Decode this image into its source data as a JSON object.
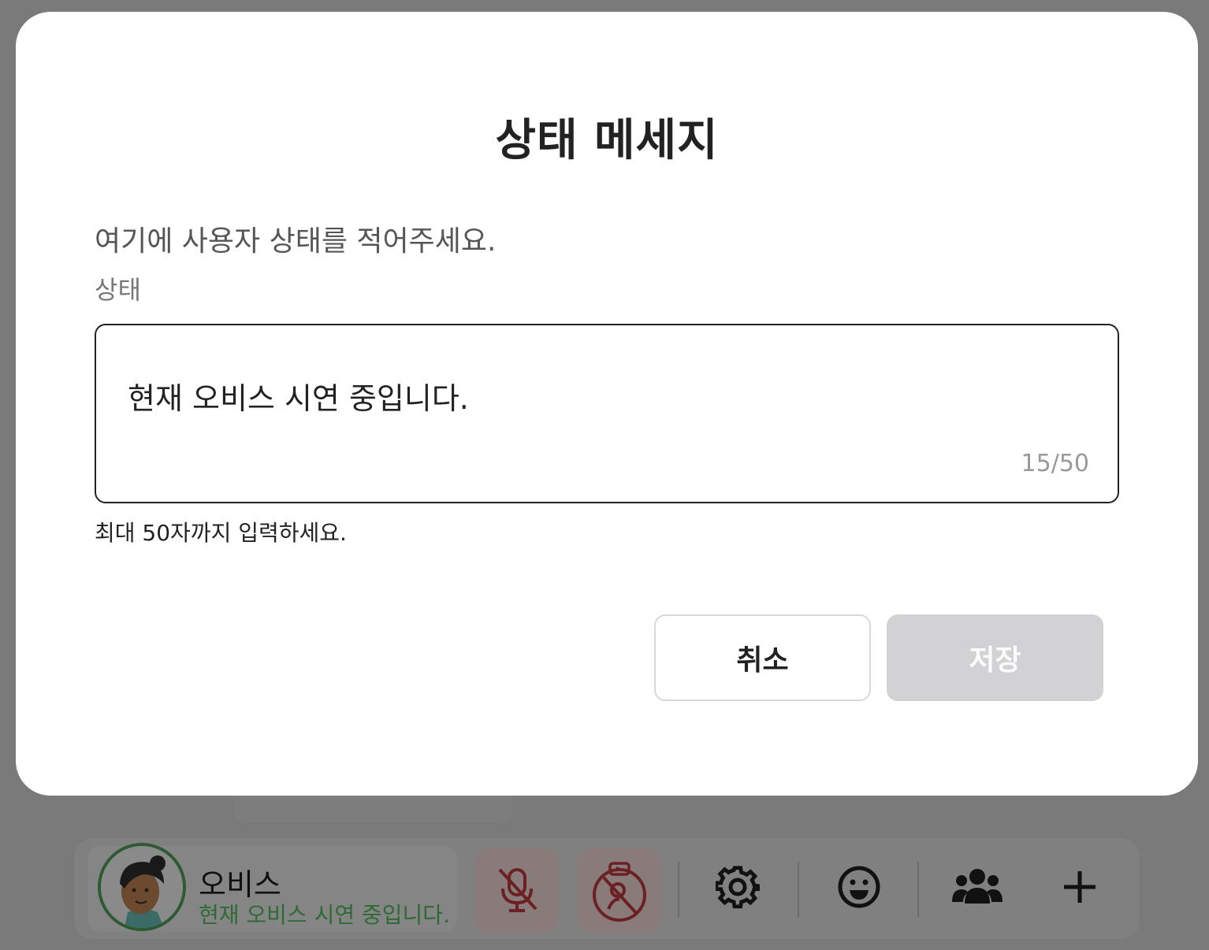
{
  "modal": {
    "title": "상태 메세지",
    "description": "여기에 사용자 상태를 적어주세요.",
    "field_label": "상태",
    "input_value": "현재 오비스 시연 중입니다.",
    "char_count": "15/50",
    "helper_text": "최대 50자까지 입력하세요.",
    "cancel_label": "취소",
    "save_label": "저장"
  },
  "toolbar": {
    "user_name": "오비스",
    "user_status": "현재 오비스 시연 중입니다.",
    "icons": [
      "mic-off-icon",
      "camera-off-icon",
      "gear-icon",
      "emoji-icon",
      "users-icon",
      "plus-icon"
    ]
  },
  "colors": {
    "overlay": "#7a7a7a",
    "modal_bg": "#ffffff",
    "save_disabled": "#d2d2d4",
    "status_green": "#2e6b34",
    "avatar_ring": "#2e5a33"
  }
}
